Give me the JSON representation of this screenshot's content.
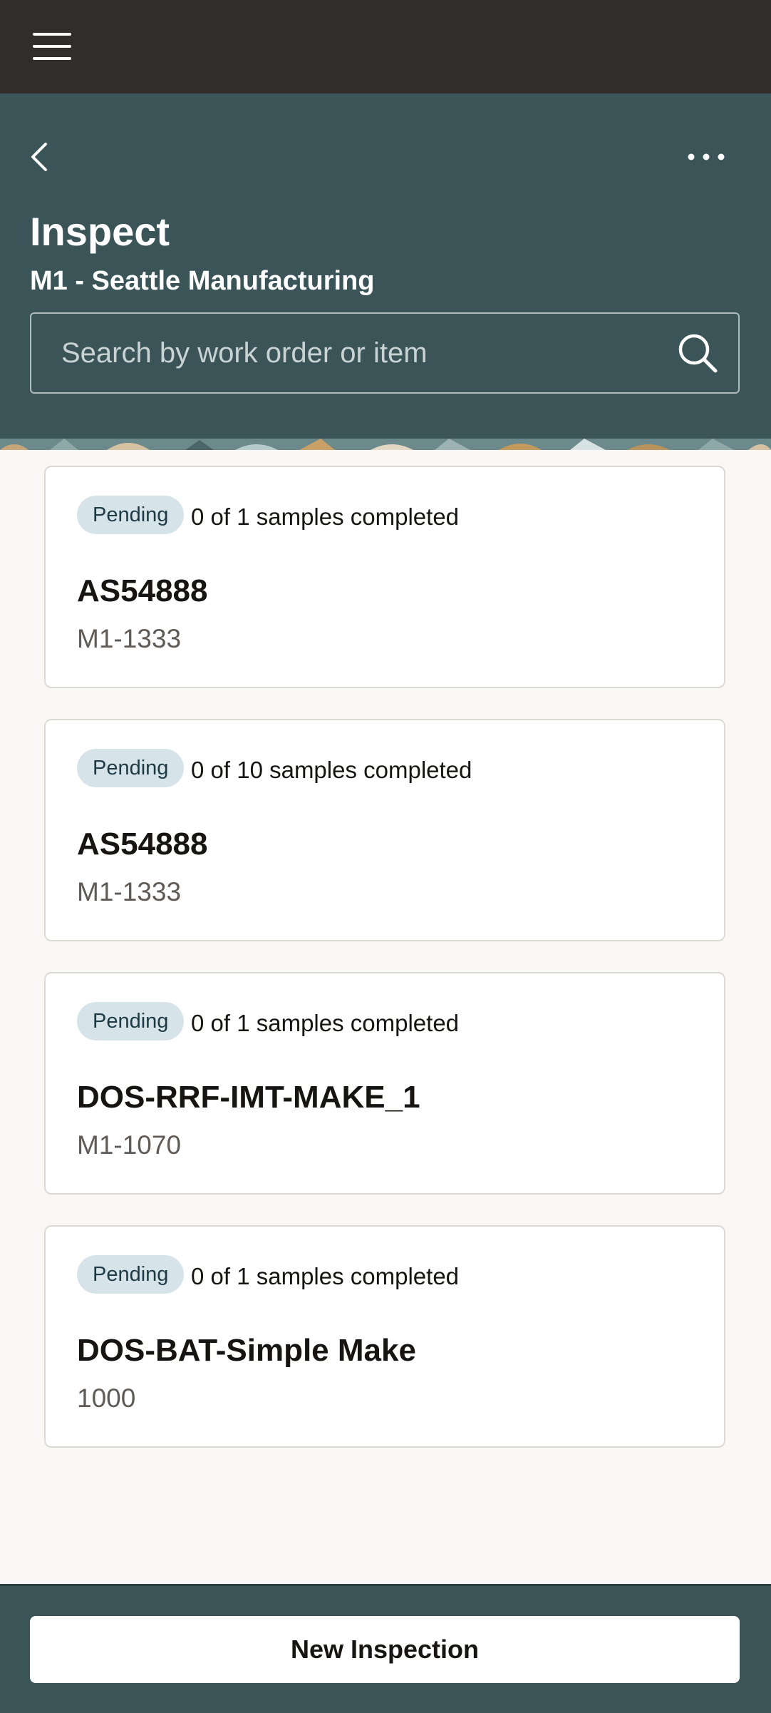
{
  "header": {
    "title": "Inspect",
    "subtitle": "M1 - Seattle Manufacturing"
  },
  "search": {
    "placeholder": "Search by work order or item",
    "value": ""
  },
  "icons": {
    "menu": "hamburger-menu-icon",
    "back": "chevron-left-icon",
    "more": "more-horizontal-icon",
    "search": "search-icon"
  },
  "colors": {
    "topbar": "#312d2a",
    "header": "#3a5457",
    "badge": "#d6e4ea"
  },
  "cards": [
    {
      "status": "Pending",
      "samples": "0 of 1 samples completed",
      "title": "AS54888",
      "sub": "M1-1333"
    },
    {
      "status": "Pending",
      "samples": "0 of 10 samples completed",
      "title": "AS54888",
      "sub": "M1-1333"
    },
    {
      "status": "Pending",
      "samples": "0 of 1 samples completed",
      "title": "DOS-RRF-IMT-MAKE_1",
      "sub": "M1-1070"
    },
    {
      "status": "Pending",
      "samples": "0 of 1 samples completed",
      "title": "DOS-BAT-Simple Make",
      "sub": "1000"
    }
  ],
  "footer": {
    "button_label": "New Inspection"
  }
}
